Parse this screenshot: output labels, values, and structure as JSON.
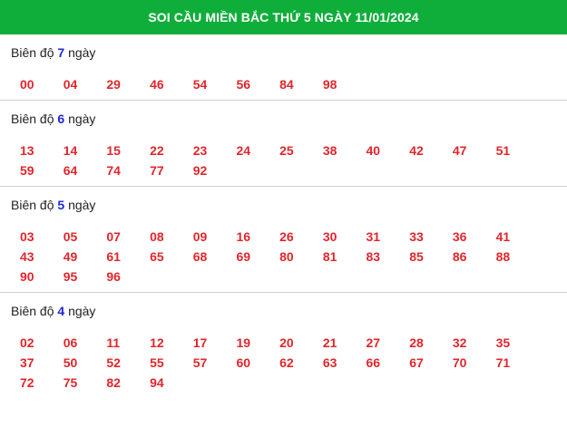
{
  "header": {
    "title": "SOI CẦU MIỀN BẮC THỨ 5 NGÀY 11/01/2024"
  },
  "sections": [
    {
      "prefix": "Biên độ",
      "amplitude": "7",
      "suffix": "ngày",
      "numbers": [
        "00",
        "04",
        "29",
        "46",
        "54",
        "56",
        "84",
        "98"
      ]
    },
    {
      "prefix": "Biên độ",
      "amplitude": "6",
      "suffix": "ngày",
      "numbers": [
        "13",
        "14",
        "15",
        "22",
        "23",
        "24",
        "25",
        "38",
        "40",
        "42",
        "47",
        "51",
        "59",
        "64",
        "74",
        "77",
        "92"
      ]
    },
    {
      "prefix": "Biên độ",
      "amplitude": "5",
      "suffix": "ngày",
      "numbers": [
        "03",
        "05",
        "07",
        "08",
        "09",
        "16",
        "26",
        "30",
        "31",
        "33",
        "36",
        "41",
        "43",
        "49",
        "61",
        "65",
        "68",
        "69",
        "80",
        "81",
        "83",
        "85",
        "86",
        "88",
        "90",
        "95",
        "96"
      ]
    },
    {
      "prefix": "Biên độ",
      "amplitude": "4",
      "suffix": "ngày",
      "numbers": [
        "02",
        "06",
        "11",
        "12",
        "17",
        "19",
        "20",
        "21",
        "27",
        "28",
        "32",
        "35",
        "37",
        "50",
        "52",
        "55",
        "57",
        "60",
        "62",
        "63",
        "66",
        "67",
        "70",
        "71",
        "72",
        "75",
        "82",
        "94"
      ]
    }
  ]
}
